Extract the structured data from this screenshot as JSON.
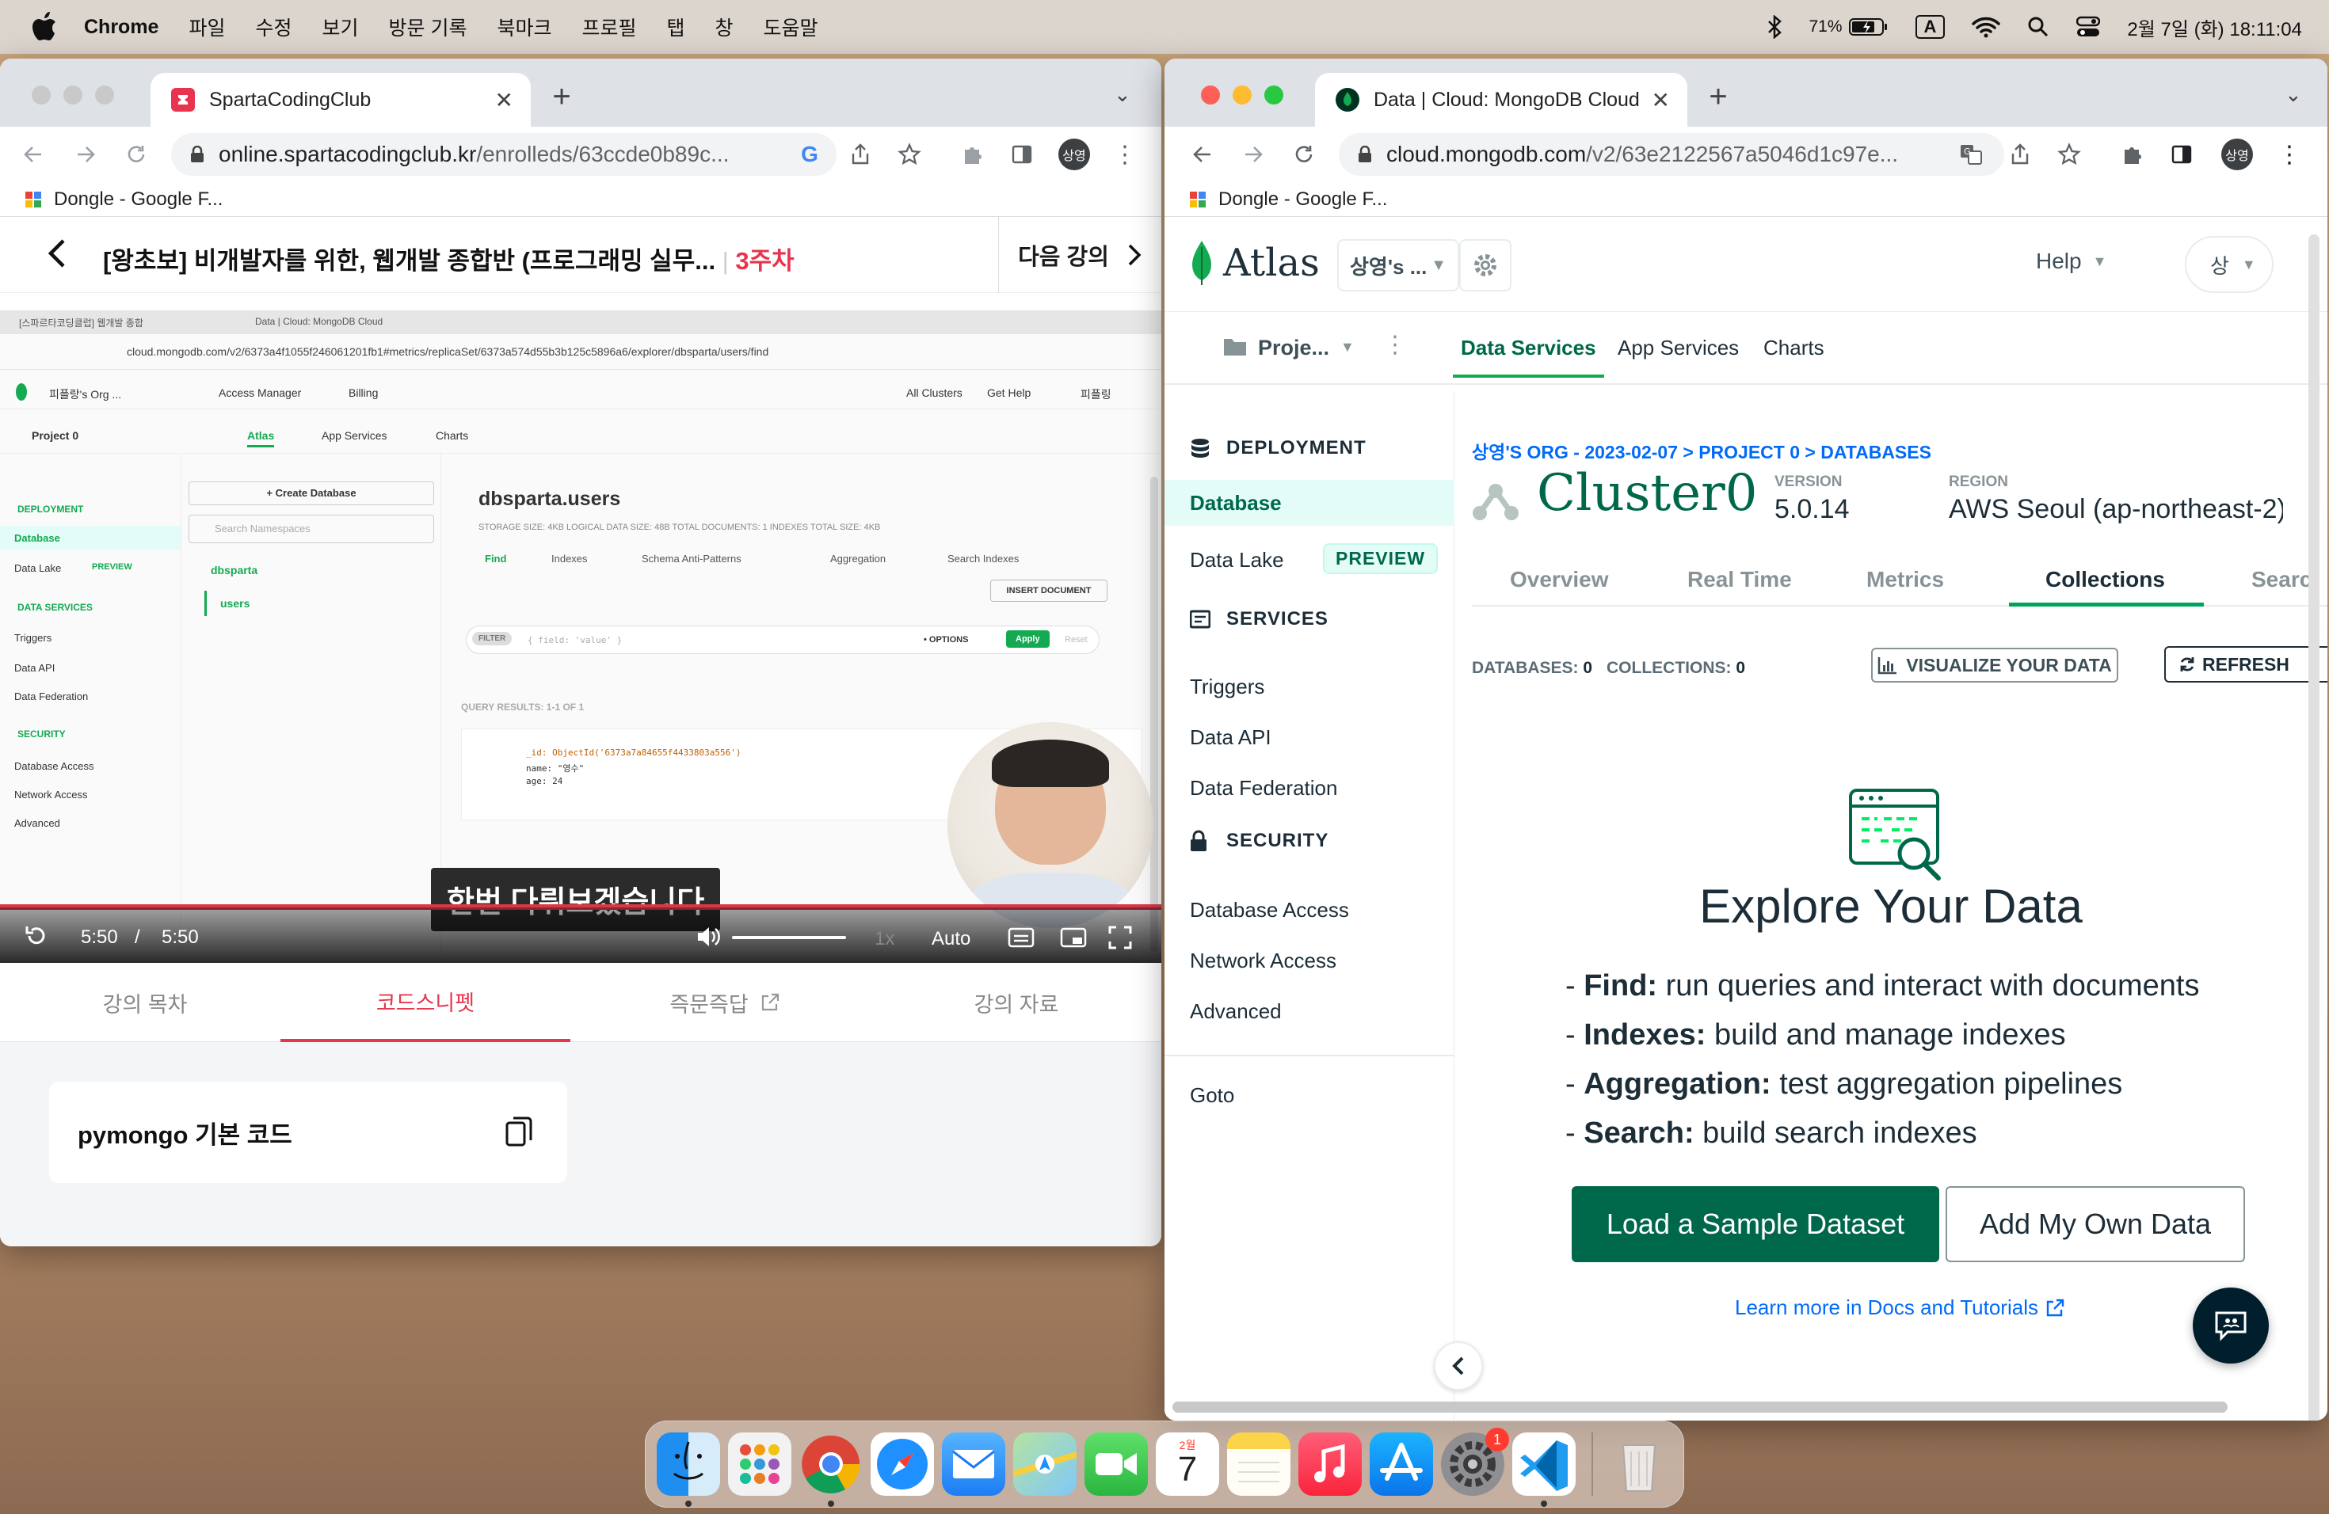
{
  "menubar": {
    "app": "Chrome",
    "items": [
      "파일",
      "수정",
      "보기",
      "방문 기록",
      "북마크",
      "프로필",
      "탭",
      "창",
      "도움말"
    ],
    "battery": "71%",
    "input_indicator": "A",
    "datetime": "2월 7일 (화) 18:11:04"
  },
  "left_window": {
    "tab_title": "SpartaCodingClub",
    "url_host": "online.spartacodingclub.kr",
    "url_path": "/enrolleds/63ccde0b89c...",
    "avatar": "상영",
    "bookmark": "Dongle - Google F...",
    "lecture": {
      "title": "[왕초보] 비개발자를 위한, 웹개발 종합반 (프로그래밍 실무...",
      "week": "3주차",
      "next": "다음 강의"
    },
    "video": {
      "subtitle": "한번 다뤄보겠습니다",
      "time_current": "5:50",
      "time_sep": "/",
      "time_total": "5:50",
      "speed": "1x",
      "quality": "Auto",
      "inner": {
        "tab1": "[스파르타코딩클럽] 웹개발 종합",
        "tab2": "Data | Cloud: MongoDB Cloud",
        "url": "cloud.mongodb.com/v2/6373a4f1055f246061201fb1#metrics/replicaSet/6373a574d55b3b125c5896a6/explorer/dbsparta/users/find",
        "org": "피플랑's Org ...",
        "access_manager": "Access Manager",
        "billing": "Billing",
        "all_clusters": "All Clusters",
        "get_help": "Get Help",
        "user": "피플링",
        "project": "Project 0",
        "nav": [
          "Atlas",
          "App Services",
          "Charts"
        ],
        "side": {
          "deployment": "DEPLOYMENT",
          "database": "Database",
          "data_lake": "Data Lake",
          "preview": "PREVIEW",
          "data_services": "DATA SERVICES",
          "triggers": "Triggers",
          "data_api": "Data API",
          "data_federation": "Data Federation",
          "security": "SECURITY",
          "database_access": "Database Access",
          "network_access": "Network Access",
          "advanced": "Advanced"
        },
        "create_db": "+ Create Database",
        "search_ns": "Search Namespaces",
        "db_name": "dbsparta",
        "coll_name": "users",
        "heading": "dbsparta.users",
        "stats": "STORAGE SIZE: 4KB      LOGICAL DATA SIZE: 48B      TOTAL DOCUMENTS: 1      INDEXES TOTAL SIZE: 4KB",
        "tabs": [
          "Find",
          "Indexes",
          "Schema Anti-Patterns",
          "Aggregation",
          "Search Indexes"
        ],
        "insert_doc": "INSERT DOCUMENT",
        "filter": "FILTER",
        "filter_ph": "{ field: 'value' }",
        "options": "• OPTIONS",
        "apply": "Apply",
        "reset": "Reset",
        "query_results": "QUERY RESULTS: 1-1 OF 1",
        "doc_id": "_id: ObjectId('6373a7a84655f4433803a556')",
        "doc_name": "name: \"영수\"",
        "doc_age": "age: 24"
      }
    },
    "tabs": [
      "강의 목차",
      "코드스니펫",
      "즉문즉답",
      "강의 자료"
    ],
    "snippet": "pymongo 기본 코드"
  },
  "right_window": {
    "tab_title": "Data | Cloud: MongoDB Cloud",
    "url_host": "cloud.mongodb.com",
    "url_path": "/v2/63e2122567a5046d1c97e...",
    "avatar": "상영",
    "bookmark": "Dongle - Google F...",
    "atlas": {
      "logo": "Atlas",
      "org": "상영's ...",
      "help": "Help",
      "user": "상",
      "project": "Proje...",
      "nav": [
        "Data Services",
        "App Services",
        "Charts"
      ],
      "sidebar": {
        "deployment": "DEPLOYMENT",
        "database": "Database",
        "data_lake": "Data Lake",
        "preview": "PREVIEW",
        "services": "SERVICES",
        "triggers": "Triggers",
        "data_api": "Data API",
        "data_federation": "Data Federation",
        "security": "SECURITY",
        "database_access": "Database Access",
        "network_access": "Network Access",
        "advanced": "Advanced",
        "goto": "Goto"
      },
      "breadcrumb": "상영'S ORG - 2023-02-07 > PROJECT 0 > DATABASES",
      "cluster": "Cluster0",
      "version_label": "VERSION",
      "version": "5.0.14",
      "region_label": "REGION",
      "region": "AWS Seoul (ap-northeast-2)",
      "cluster_tabs": [
        "Overview",
        "Real Time",
        "Metrics",
        "Collections",
        "Search"
      ],
      "databases_label": "DATABASES:",
      "databases": "0",
      "collections_label": "COLLECTIONS:",
      "collections": "0",
      "visualize": "VISUALIZE YOUR DATA",
      "refresh": "REFRESH",
      "explore_title": "Explore Your Data",
      "features": [
        {
          "bold": "Find:",
          "text": " run queries and interact with documents"
        },
        {
          "bold": "Indexes:",
          "text": " build and manage indexes"
        },
        {
          "bold": "Aggregation:",
          "text": " test aggregation pipelines"
        },
        {
          "bold": "Search:",
          "text": " build search indexes"
        }
      ],
      "dash": "-",
      "load_sample": "Load a Sample Dataset",
      "add_own": "Add My Own Data",
      "learn_more": "Learn more in Docs and Tutorials"
    }
  },
  "dock": {
    "calendar_month": "2월",
    "calendar_day": "7",
    "settings_badge": "1"
  },
  "colors": {
    "mongo_green": "#13aa52",
    "mongo_dark": "#21313c",
    "sparta_red": "#e8344e",
    "link_blue": "#016bf8"
  }
}
